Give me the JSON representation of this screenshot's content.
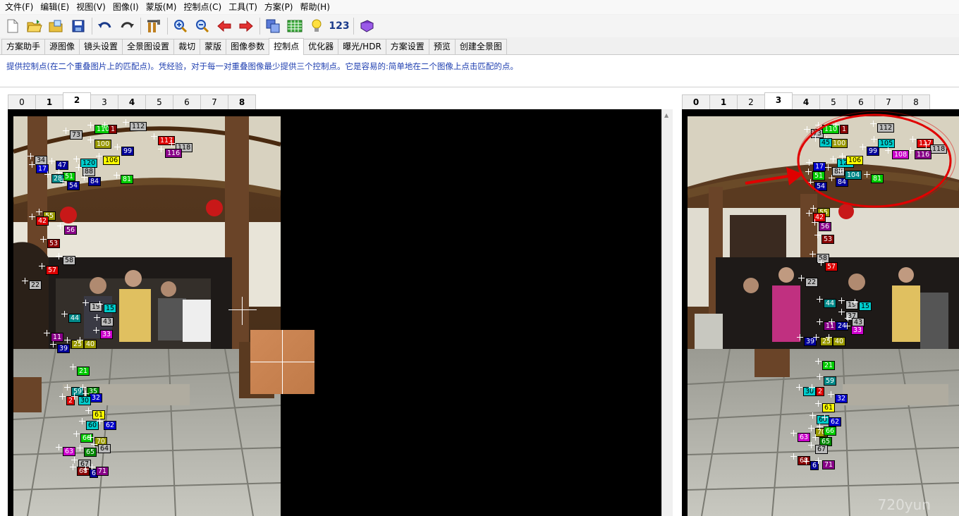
{
  "menu": [
    "文件(F)",
    "编辑(E)",
    "视图(V)",
    "图像(I)",
    "蒙版(M)",
    "控制点(C)",
    "工具(T)",
    "方案(P)",
    "帮助(H)"
  ],
  "toolbar": {
    "icons": [
      "new-file-icon",
      "open-folder-icon",
      "open-images-icon",
      "save-icon",
      "undo-icon",
      "redo-icon",
      "fit-panorama-icon",
      "zoom-in-icon",
      "zoom-out-icon",
      "previous-image-icon",
      "next-image-icon",
      "image-stack-icon",
      "table-icon",
      "tip-bulb-icon",
      "book-icon"
    ],
    "number_label": "123"
  },
  "tabs": [
    "方案助手",
    "源图像",
    "镜头设置",
    "全景图设置",
    "裁切",
    "蒙版",
    "图像参数",
    "控制点",
    "优化器",
    "曝光/HDR",
    "方案设置",
    "预览",
    "创建全景图"
  ],
  "active_tab": "控制点",
  "description": "提供控制点(在二个重叠图片上的匹配点)。凭经验，对于每一对重叠图像最少提供三个控制点。它是容易的:简单地在二个图像上点击匹配的点。",
  "left_pane": {
    "image_tabs": [
      "0",
      "1",
      "2",
      "3",
      "4",
      "5",
      "6",
      "7",
      "8"
    ],
    "active": "2",
    "control_points": [
      {
        "label": "73",
        "color": "#bbbbbb"
      },
      {
        "label": "110",
        "color": "#00cc00"
      },
      {
        "label": "1",
        "color": "#880000"
      },
      {
        "label": "112",
        "color": "#bbbbbb"
      },
      {
        "label": "100",
        "color": "#999900"
      },
      {
        "label": "117",
        "color": "#dd0000"
      },
      {
        "label": "118",
        "color": "#bbbbbb"
      },
      {
        "label": "99",
        "color": "#000099"
      },
      {
        "label": "116",
        "color": "#880088"
      },
      {
        "label": "34",
        "color": "#bbbbbb"
      },
      {
        "label": "17",
        "color": "#0000cc"
      },
      {
        "label": "47",
        "color": "#000099"
      },
      {
        "label": "120",
        "color": "#00cccc"
      },
      {
        "label": "106",
        "color": "#ffff00"
      },
      {
        "label": "88",
        "color": "#bbbbbb"
      },
      {
        "label": "51",
        "color": "#00cc00"
      },
      {
        "label": "28",
        "color": "#008888"
      },
      {
        "label": "54",
        "color": "#000099"
      },
      {
        "label": "84",
        "color": "#000099"
      },
      {
        "label": "81",
        "color": "#00cc00"
      },
      {
        "label": "55",
        "color": "#999900"
      },
      {
        "label": "42",
        "color": "#dd0000"
      },
      {
        "label": "56",
        "color": "#880088"
      },
      {
        "label": "53",
        "color": "#880000"
      },
      {
        "label": "58",
        "color": "#bbbbbb"
      },
      {
        "label": "57",
        "color": "#dd0000"
      },
      {
        "label": "22",
        "color": "#bbbbbb"
      },
      {
        "label": "19",
        "color": "#bbbbbb"
      },
      {
        "label": "15",
        "color": "#00cccc"
      },
      {
        "label": "44",
        "color": "#008888"
      },
      {
        "label": "43",
        "color": "#bbbbbb"
      },
      {
        "label": "11",
        "color": "#880088"
      },
      {
        "label": "33",
        "color": "#cc00cc"
      },
      {
        "label": "25",
        "color": "#999900"
      },
      {
        "label": "40",
        "color": "#999900"
      },
      {
        "label": "39",
        "color": "#000099"
      },
      {
        "label": "21",
        "color": "#00cc00"
      },
      {
        "label": "59",
        "color": "#008888"
      },
      {
        "label": "35",
        "color": "#008800"
      },
      {
        "label": "32",
        "color": "#0000cc"
      },
      {
        "label": "2",
        "color": "#dd0000"
      },
      {
        "label": "30",
        "color": "#00cccc"
      },
      {
        "label": "61",
        "color": "#ffff00"
      },
      {
        "label": "60",
        "color": "#00cccc"
      },
      {
        "label": "62",
        "color": "#0000cc"
      },
      {
        "label": "66",
        "color": "#00cc00"
      },
      {
        "label": "70",
        "color": "#999900"
      },
      {
        "label": "64",
        "color": "#bbbbbb"
      },
      {
        "label": "63",
        "color": "#cc00cc"
      },
      {
        "label": "65",
        "color": "#008800"
      },
      {
        "label": "67",
        "color": "#bbbbbb"
      },
      {
        "label": "68",
        "color": "#880000"
      },
      {
        "label": "6",
        "color": "#000099"
      },
      {
        "label": "71",
        "color": "#880088"
      }
    ]
  },
  "right_pane": {
    "image_tabs": [
      "0",
      "1",
      "2",
      "3",
      "4",
      "5",
      "6",
      "7",
      "8"
    ],
    "active": "3",
    "control_points": [
      {
        "label": "73",
        "color": "#bbbbbb"
      },
      {
        "label": "110",
        "color": "#00cc00"
      },
      {
        "label": "1",
        "color": "#880000"
      },
      {
        "label": "112",
        "color": "#bbbbbb"
      },
      {
        "label": "100",
        "color": "#999900"
      },
      {
        "label": "117",
        "color": "#dd0000"
      },
      {
        "label": "118",
        "color": "#bbbbbb"
      },
      {
        "label": "99",
        "color": "#000099"
      },
      {
        "label": "116",
        "color": "#880088"
      },
      {
        "label": "105",
        "color": "#00cccc"
      },
      {
        "label": "108",
        "color": "#cc00cc"
      },
      {
        "label": "45",
        "color": "#00cccc"
      },
      {
        "label": "17",
        "color": "#0000cc"
      },
      {
        "label": "120",
        "color": "#00cccc"
      },
      {
        "label": "106",
        "color": "#ffff00"
      },
      {
        "label": "88",
        "color": "#bbbbbb"
      },
      {
        "label": "51",
        "color": "#00cc00"
      },
      {
        "label": "54",
        "color": "#000099"
      },
      {
        "label": "84",
        "color": "#000099"
      },
      {
        "label": "104",
        "color": "#008888"
      },
      {
        "label": "81",
        "color": "#00cc00"
      },
      {
        "label": "55",
        "color": "#999900"
      },
      {
        "label": "42",
        "color": "#dd0000"
      },
      {
        "label": "56",
        "color": "#880088"
      },
      {
        "label": "53",
        "color": "#880000"
      },
      {
        "label": "58",
        "color": "#bbbbbb"
      },
      {
        "label": "57",
        "color": "#dd0000"
      },
      {
        "label": "22",
        "color": "#bbbbbb"
      },
      {
        "label": "44",
        "color": "#008888"
      },
      {
        "label": "19",
        "color": "#bbbbbb"
      },
      {
        "label": "15",
        "color": "#00cccc"
      },
      {
        "label": "37",
        "color": "#bbbbbb"
      },
      {
        "label": "43",
        "color": "#bbbbbb"
      },
      {
        "label": "11",
        "color": "#880088"
      },
      {
        "label": "24",
        "color": "#000099"
      },
      {
        "label": "33",
        "color": "#cc00cc"
      },
      {
        "label": "39",
        "color": "#000099"
      },
      {
        "label": "25",
        "color": "#999900"
      },
      {
        "label": "40",
        "color": "#999900"
      },
      {
        "label": "21",
        "color": "#00cc00"
      },
      {
        "label": "59",
        "color": "#008888"
      },
      {
        "label": "30",
        "color": "#00cccc"
      },
      {
        "label": "2",
        "color": "#dd0000"
      },
      {
        "label": "32",
        "color": "#0000cc"
      },
      {
        "label": "61",
        "color": "#ffff00"
      },
      {
        "label": "60",
        "color": "#00cccc"
      },
      {
        "label": "62",
        "color": "#0000cc"
      },
      {
        "label": "70",
        "color": "#999900"
      },
      {
        "label": "66",
        "color": "#00cc00"
      },
      {
        "label": "63",
        "color": "#cc00cc"
      },
      {
        "label": "65",
        "color": "#008800"
      },
      {
        "label": "67",
        "color": "#bbbbbb"
      },
      {
        "label": "68",
        "color": "#880000"
      },
      {
        "label": "6",
        "color": "#000099"
      },
      {
        "label": "71",
        "color": "#880088"
      }
    ]
  },
  "watermark": "720yun"
}
